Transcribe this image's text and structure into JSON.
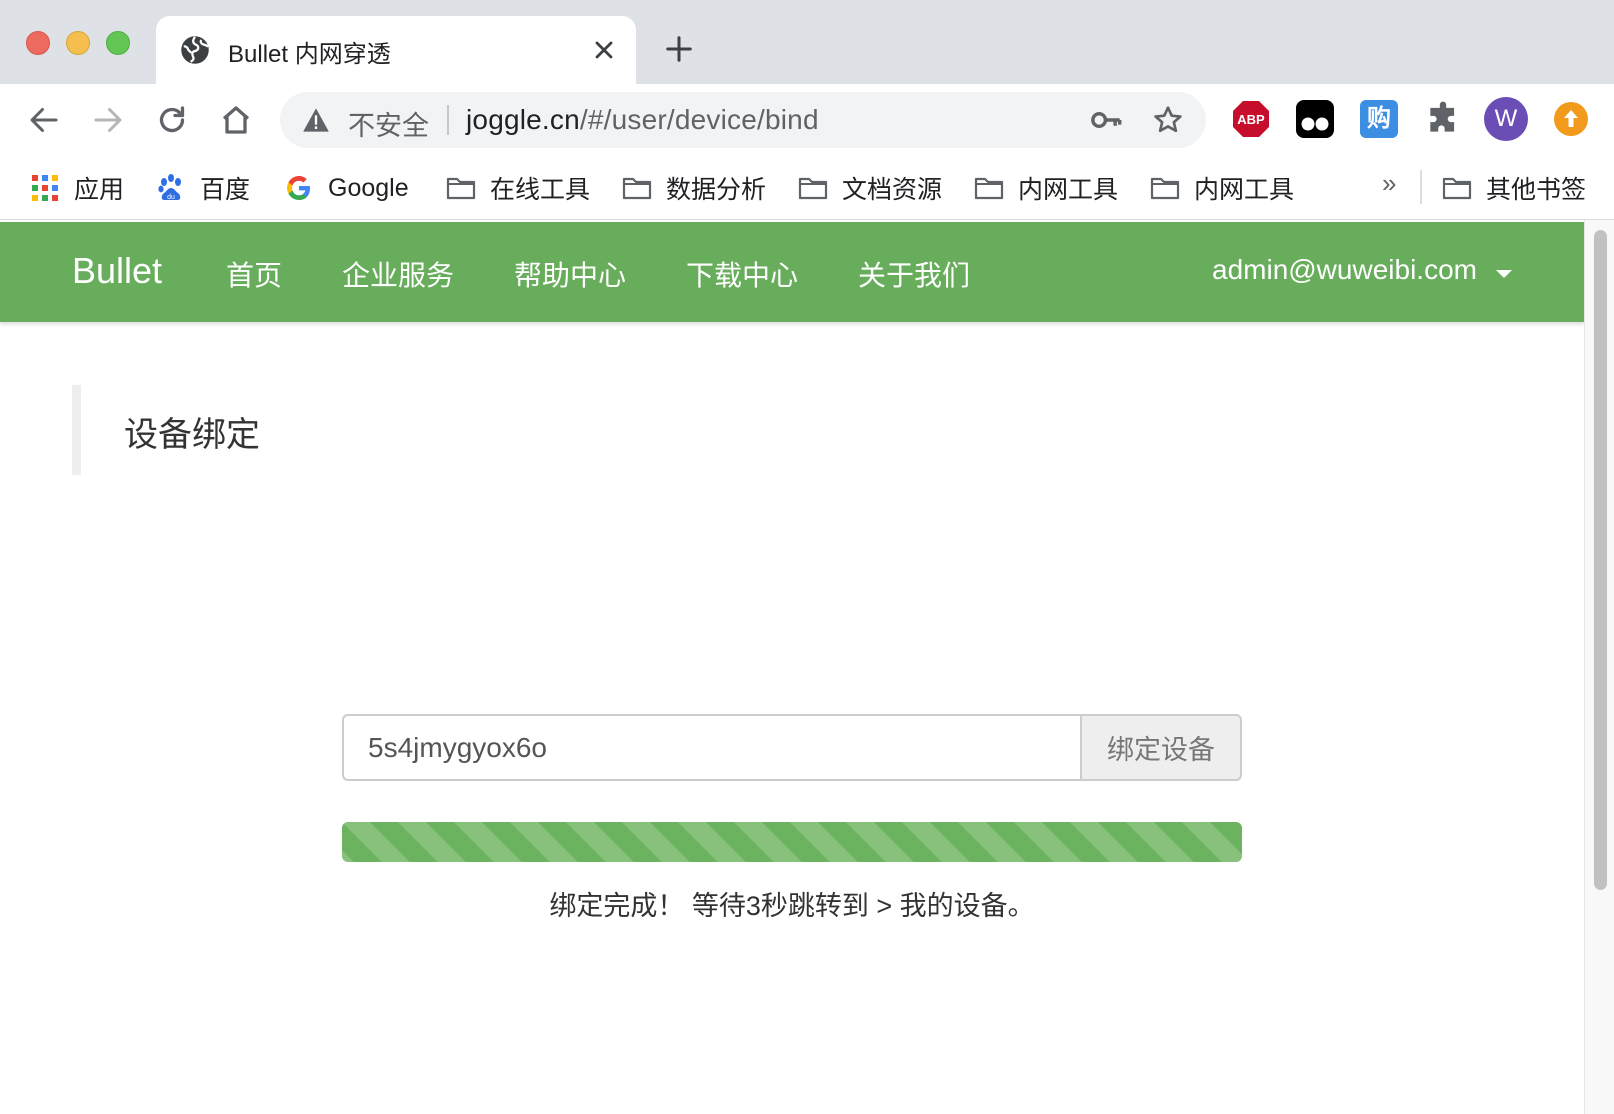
{
  "browser": {
    "tab_title": "Bullet 内网穿透",
    "omnibox": {
      "security_label": "不安全",
      "url_host": "joggle.cn",
      "url_path": "/#/user/device/bind"
    },
    "extensions": {
      "abp_label": "ABP",
      "gou_label": "购",
      "avatar_letter": "W"
    },
    "bookmarks": [
      {
        "label": "应用",
        "icon": "apps-grid-icon"
      },
      {
        "label": "百度",
        "icon": "baidu-paw-icon"
      },
      {
        "label": "Google",
        "icon": "google-g-icon"
      },
      {
        "label": "在线工具",
        "icon": "folder-icon"
      },
      {
        "label": "数据分析",
        "icon": "folder-icon"
      },
      {
        "label": "文档资源",
        "icon": "folder-icon"
      },
      {
        "label": "内网工具",
        "icon": "folder-icon"
      },
      {
        "label": "内网工具",
        "icon": "folder-icon"
      }
    ],
    "bookmarks_more": "»",
    "other_bookmarks": "其他书签"
  },
  "navbar": {
    "brand": "Bullet",
    "links": [
      "首页",
      "企业服务",
      "帮助中心",
      "下载中心",
      "关于我们"
    ],
    "user": "admin@wuweibi.com"
  },
  "main": {
    "section_title": "设备绑定",
    "device_code": "5s4jmygyox6o",
    "bind_button": "绑定设备",
    "progress_percent": 100,
    "status_message": "绑定完成！ 等待3秒跳转到 > 我的设备。"
  },
  "colors": {
    "navbar_green": "#67ad5b",
    "progress_green": "#6cb35f"
  }
}
